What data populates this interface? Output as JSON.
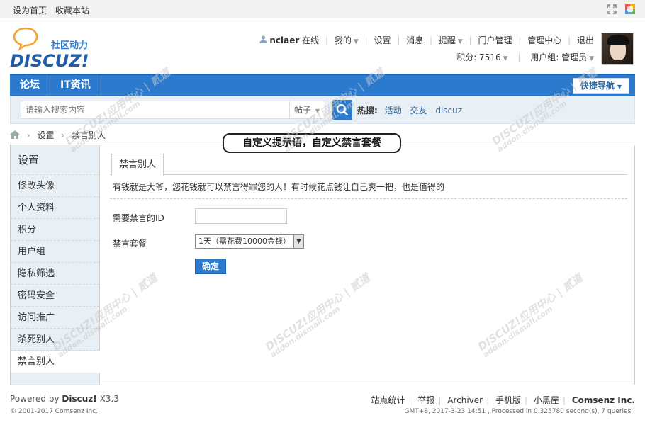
{
  "topbar": {
    "set_home": "设为首页",
    "bookmark": "收藏本站"
  },
  "logo": {
    "tagline": "社区动力",
    "brand": "DISCUZ!"
  },
  "user": {
    "name": "nciaer",
    "status": "在线",
    "menu": [
      "我的",
      "设置",
      "消息",
      "提醒",
      "门户管理",
      "管理中心",
      "退出"
    ],
    "credits": "积分: 7516",
    "group": "用户组: 管理员"
  },
  "nav": {
    "items": [
      "论坛",
      "IT资讯"
    ],
    "quick": "快捷导航"
  },
  "search": {
    "placeholder": "请输入搜索内容",
    "type": "帖子",
    "hot_label": "热搜:",
    "hot_tags": [
      "活动",
      "交友",
      "discuz"
    ]
  },
  "breadcrumb": {
    "items": [
      "设置",
      "禁言别人"
    ]
  },
  "callout": "自定义提示语，自定义禁言套餐",
  "sidebar": {
    "title": "设置",
    "items": [
      "修改头像",
      "个人资料",
      "积分",
      "用户组",
      "隐私筛选",
      "密码安全",
      "访问推广",
      "杀死别人",
      "禁言别人"
    ],
    "active": "禁言别人"
  },
  "content": {
    "tab": "禁言别人",
    "tip": "有钱就是大爷，您花钱就可以禁言得罪您的人！有时候花点钱让自己爽一把，也是值得的",
    "id_label": "需要禁言的ID",
    "id_value": "",
    "plan_label": "禁言套餐",
    "plan_value": "1天（需花费10000金钱）",
    "submit": "确定"
  },
  "footer": {
    "powered": "Powered by",
    "brand": "Discuz!",
    "version": "X3.3",
    "copyright": "© 2001-2017 Comsenz Inc.",
    "links": [
      "站点统计",
      "举报",
      "Archiver",
      "手机版",
      "小黑屋"
    ],
    "company": "Comsenz Inc.",
    "meta": "GMT+8, 2017-3-23 14:51 , Processed in 0.325780 second(s), 7 queries ."
  },
  "watermark": [
    "DISCUZ!应用中心",
    "addon.dismall.com",
    "贰道"
  ],
  "colors": {
    "nav_blue": "#2b7acd",
    "sidebar_bg": "#e8eff5",
    "link_blue": "#336699"
  },
  "icons": [
    "person-icon",
    "search-icon",
    "home-icon",
    "fullscreen-icon",
    "colorful-app-icon",
    "caret-down-icon"
  ]
}
